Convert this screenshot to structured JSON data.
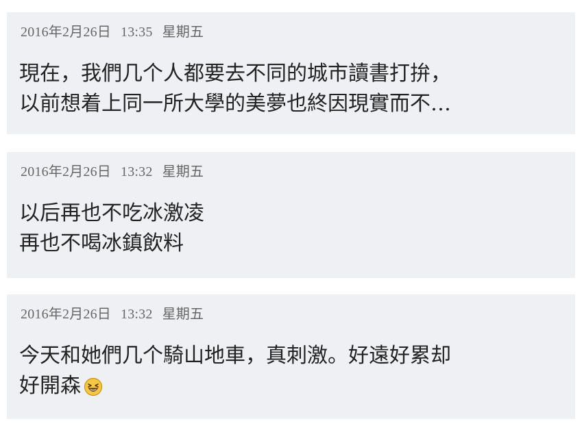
{
  "posts": [
    {
      "date": "2016年2月26日",
      "time": "13:35",
      "weekday": "星期五",
      "lines": [
        "現在，我們几个人都要去不同的城市讀書打拚，",
        "以前想着上同一所大學的美夢也終因現實而不…"
      ]
    },
    {
      "date": "2016年2月26日",
      "time": "13:32",
      "weekday": "星期五",
      "lines": [
        "以后再也不吃冰激凌",
        "再也不喝冰鎮飲料"
      ]
    },
    {
      "date": "2016年2月26日",
      "time": "13:32",
      "weekday": "星期五",
      "lines": [
        "今天和她們几个騎山地車，真刺激。好遠好累却",
        "好開森"
      ],
      "emoji": "laughing-face-icon"
    }
  ],
  "colors": {
    "card_background": "#eef0f3",
    "meta_text": "#666666",
    "body_text": "#222222",
    "emoji_face": "#f6c744"
  }
}
